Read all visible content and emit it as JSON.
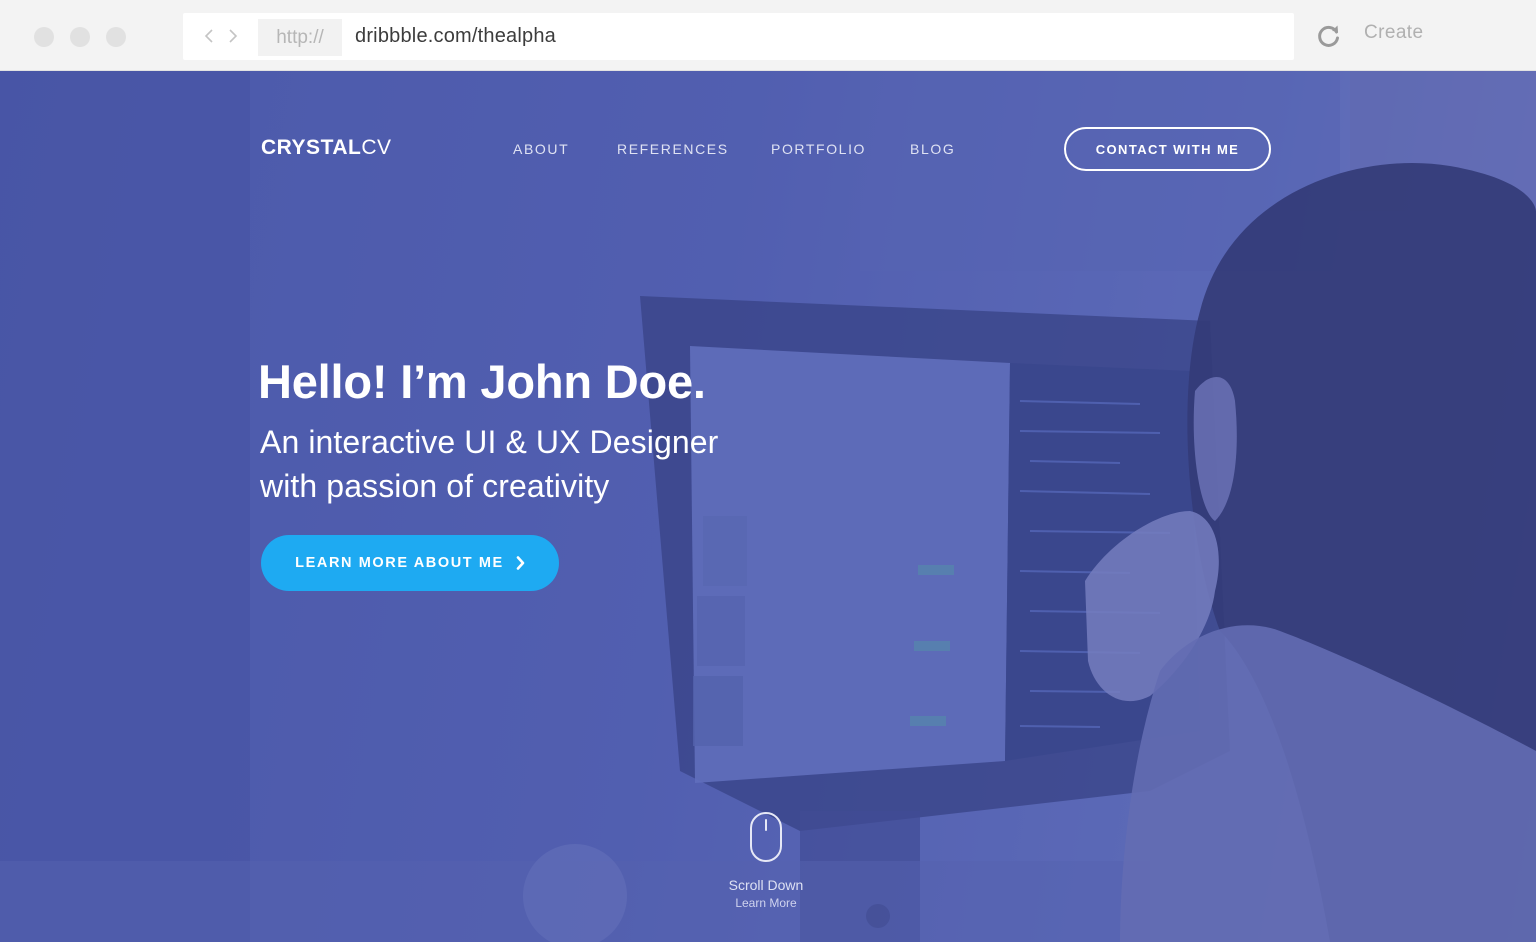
{
  "browser": {
    "protocol": "http://",
    "url": "dribbble.com/thealpha",
    "create_label": "Create"
  },
  "site": {
    "logo_bold": "CRYSTAL",
    "logo_light": "CV",
    "nav": [
      "ABOUT",
      "REFERENCES",
      "PORTFOLIO",
      "BLOG"
    ],
    "contact_button": "CONTACT WITH ME"
  },
  "hero": {
    "headline": "Hello! I’m John Doe.",
    "subline_1": "An interactive UI & UX Designer",
    "subline_2": "with passion of creativity",
    "cta_label": "LEARN MORE ABOUT ME",
    "scroll_title": "Scroll Down",
    "scroll_sub": "Learn More"
  },
  "colors": {
    "overlay": "#4f5cab",
    "cta": "#1eaaf2",
    "chrome": "#f3f3f3"
  }
}
